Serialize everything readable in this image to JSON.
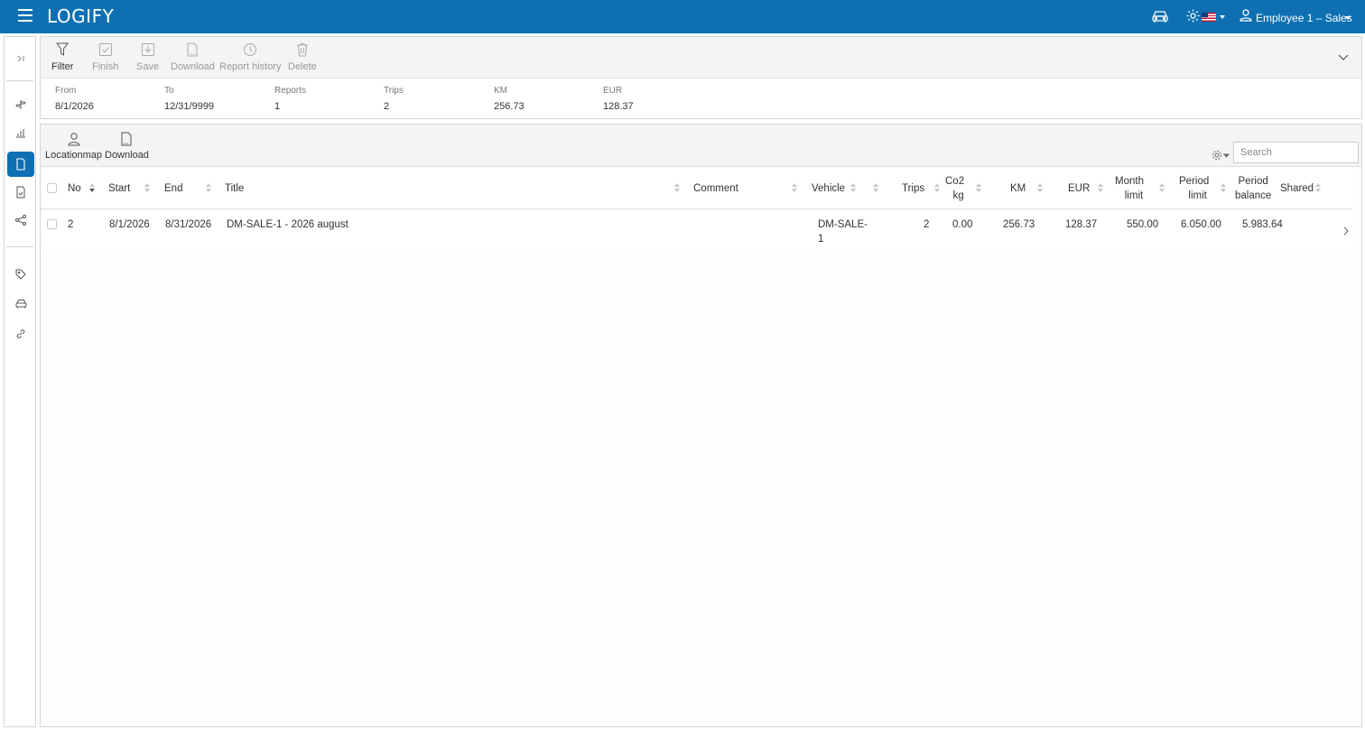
{
  "header": {
    "logo": "LOGIFY",
    "user_name": "Employee 1 – Sales"
  },
  "toolbar": {
    "filter": "Filter",
    "finish": "Finish",
    "save": "Save",
    "download": "Download",
    "report_history": "Report history",
    "delete": "Delete"
  },
  "summary": {
    "from_label": "From",
    "from_value": "8/1/2026",
    "to_label": "To",
    "to_value": "12/31/9999",
    "reports_label": "Reports",
    "reports_value": "1",
    "trips_label": "Trips",
    "trips_value": "2",
    "km_label": "KM",
    "km_value": "256.73",
    "eur_label": "EUR",
    "eur_value": "128.37"
  },
  "grid_toolbar": {
    "locationmap": "Locationmap",
    "download": "Download",
    "search_placeholder": "Search"
  },
  "columns": {
    "no": "No",
    "start": "Start",
    "end": "End",
    "title": "Title",
    "comment": "Comment",
    "vehicle": "Vehicle",
    "trips": "Trips",
    "co2_line1": "Co2",
    "co2_line2": "kg",
    "km": "KM",
    "eur": "EUR",
    "month_limit_line1": "Month",
    "month_limit_line2": "limit",
    "period_limit_line1": "Period",
    "period_limit_line2": "limit",
    "period_balance_line1": "Period",
    "period_balance_line2": "balance",
    "shared": "Shared"
  },
  "rows": [
    {
      "no": "2",
      "start": "8/1/2026",
      "end": "8/31/2026",
      "title": "DM-SALE-1 - 2026 august",
      "comment": "",
      "vehicle_line1": "DM-SALE-",
      "vehicle_line2": "1",
      "trips": "2",
      "co2": "0.00",
      "km": "256.73",
      "eur": "128.37",
      "month_limit": "550.00",
      "period_limit": "6.050.00",
      "period_balance": "5.983.64",
      "shared": ""
    }
  ],
  "colors": {
    "brand": "#0e70b2",
    "toolbar_bg": "#f4f4f4",
    "border": "#d6d6d6"
  }
}
